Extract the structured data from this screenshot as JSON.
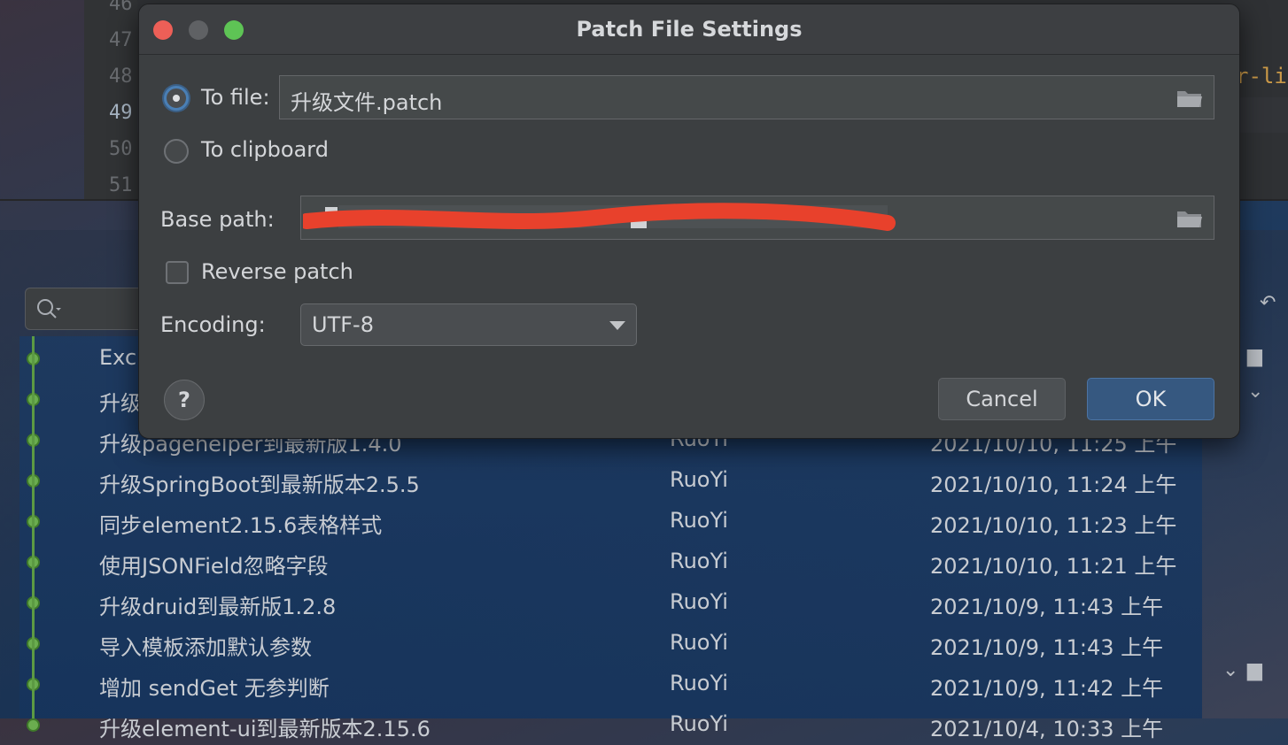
{
  "editor": {
    "line_numbers": [
      "46",
      "47",
      "48",
      "49",
      "50",
      "51"
    ],
    "current_line": "49",
    "code_fragment": "r-li"
  },
  "log": {
    "rows": [
      {
        "message": "Exc",
        "author": "",
        "date": ""
      },
      {
        "message": "升级",
        "author": "",
        "date": ""
      },
      {
        "message": "升级pagehelper到最新版1.4.0",
        "author": "RuoYi",
        "date": "2021/10/10, 11:25 上午"
      },
      {
        "message": "升级SpringBoot到最新版本2.5.5",
        "author": "RuoYi",
        "date": "2021/10/10, 11:24 上午"
      },
      {
        "message": "同步element2.15.6表格样式",
        "author": "RuoYi",
        "date": "2021/10/10, 11:23 上午"
      },
      {
        "message": "使用JSONField忽略字段",
        "author": "RuoYi",
        "date": "2021/10/10, 11:21 上午"
      },
      {
        "message": "升级druid到最新版1.2.8",
        "author": "RuoYi",
        "date": "2021/10/9, 11:43 上午"
      },
      {
        "message": "导入模板添加默认参数",
        "author": "RuoYi",
        "date": "2021/10/9, 11:43 上午"
      },
      {
        "message": "增加 sendGet 无参判断",
        "author": "RuoYi",
        "date": "2021/10/9, 11:42 上午"
      },
      {
        "message": "升级element-ui到最新版本2.15.6",
        "author": "RuoYi",
        "date": "2021/10/4, 10:33 上午"
      }
    ]
  },
  "dialog": {
    "title": "Patch File Settings",
    "to_file_label": "To file:",
    "to_file_value": "升级文件.patch",
    "to_clipboard_label": "To clipboard",
    "base_path_label": "Base path:",
    "reverse_patch_label": "Reverse patch",
    "encoding_label": "Encoding:",
    "encoding_value": "UTF-8",
    "help_label": "?",
    "cancel_label": "Cancel",
    "ok_label": "OK",
    "selected_destination": "to_file",
    "reverse_patch_checked": false
  },
  "colors": {
    "dialog_bg": "#3c3f41",
    "primary_button": "#365880",
    "redaction": "#e8412c",
    "graph_green": "#6aad4f"
  }
}
